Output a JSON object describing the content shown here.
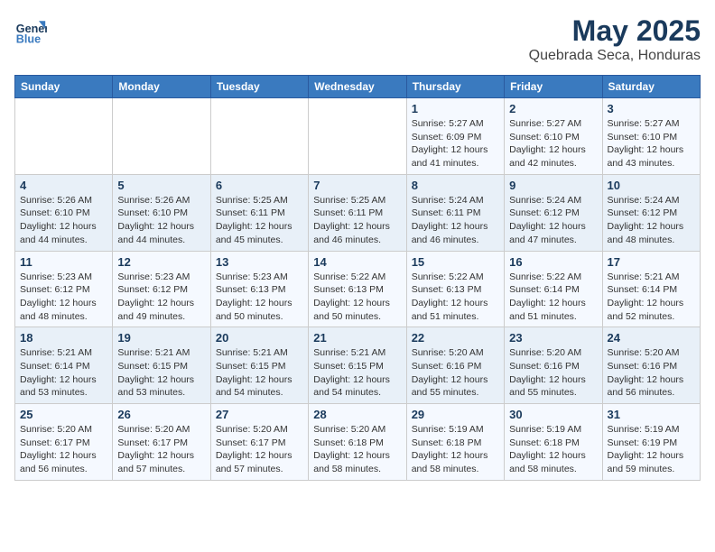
{
  "header": {
    "logo_line1": "General",
    "logo_line2": "Blue",
    "month": "May 2025",
    "location": "Quebrada Seca, Honduras"
  },
  "days_of_week": [
    "Sunday",
    "Monday",
    "Tuesday",
    "Wednesday",
    "Thursday",
    "Friday",
    "Saturday"
  ],
  "weeks": [
    [
      {
        "day": "",
        "info": ""
      },
      {
        "day": "",
        "info": ""
      },
      {
        "day": "",
        "info": ""
      },
      {
        "day": "",
        "info": ""
      },
      {
        "day": "1",
        "info": "Sunrise: 5:27 AM\nSunset: 6:09 PM\nDaylight: 12 hours\nand 41 minutes."
      },
      {
        "day": "2",
        "info": "Sunrise: 5:27 AM\nSunset: 6:10 PM\nDaylight: 12 hours\nand 42 minutes."
      },
      {
        "day": "3",
        "info": "Sunrise: 5:27 AM\nSunset: 6:10 PM\nDaylight: 12 hours\nand 43 minutes."
      }
    ],
    [
      {
        "day": "4",
        "info": "Sunrise: 5:26 AM\nSunset: 6:10 PM\nDaylight: 12 hours\nand 44 minutes."
      },
      {
        "day": "5",
        "info": "Sunrise: 5:26 AM\nSunset: 6:10 PM\nDaylight: 12 hours\nand 44 minutes."
      },
      {
        "day": "6",
        "info": "Sunrise: 5:25 AM\nSunset: 6:11 PM\nDaylight: 12 hours\nand 45 minutes."
      },
      {
        "day": "7",
        "info": "Sunrise: 5:25 AM\nSunset: 6:11 PM\nDaylight: 12 hours\nand 46 minutes."
      },
      {
        "day": "8",
        "info": "Sunrise: 5:24 AM\nSunset: 6:11 PM\nDaylight: 12 hours\nand 46 minutes."
      },
      {
        "day": "9",
        "info": "Sunrise: 5:24 AM\nSunset: 6:12 PM\nDaylight: 12 hours\nand 47 minutes."
      },
      {
        "day": "10",
        "info": "Sunrise: 5:24 AM\nSunset: 6:12 PM\nDaylight: 12 hours\nand 48 minutes."
      }
    ],
    [
      {
        "day": "11",
        "info": "Sunrise: 5:23 AM\nSunset: 6:12 PM\nDaylight: 12 hours\nand 48 minutes."
      },
      {
        "day": "12",
        "info": "Sunrise: 5:23 AM\nSunset: 6:12 PM\nDaylight: 12 hours\nand 49 minutes."
      },
      {
        "day": "13",
        "info": "Sunrise: 5:23 AM\nSunset: 6:13 PM\nDaylight: 12 hours\nand 50 minutes."
      },
      {
        "day": "14",
        "info": "Sunrise: 5:22 AM\nSunset: 6:13 PM\nDaylight: 12 hours\nand 50 minutes."
      },
      {
        "day": "15",
        "info": "Sunrise: 5:22 AM\nSunset: 6:13 PM\nDaylight: 12 hours\nand 51 minutes."
      },
      {
        "day": "16",
        "info": "Sunrise: 5:22 AM\nSunset: 6:14 PM\nDaylight: 12 hours\nand 51 minutes."
      },
      {
        "day": "17",
        "info": "Sunrise: 5:21 AM\nSunset: 6:14 PM\nDaylight: 12 hours\nand 52 minutes."
      }
    ],
    [
      {
        "day": "18",
        "info": "Sunrise: 5:21 AM\nSunset: 6:14 PM\nDaylight: 12 hours\nand 53 minutes."
      },
      {
        "day": "19",
        "info": "Sunrise: 5:21 AM\nSunset: 6:15 PM\nDaylight: 12 hours\nand 53 minutes."
      },
      {
        "day": "20",
        "info": "Sunrise: 5:21 AM\nSunset: 6:15 PM\nDaylight: 12 hours\nand 54 minutes."
      },
      {
        "day": "21",
        "info": "Sunrise: 5:21 AM\nSunset: 6:15 PM\nDaylight: 12 hours\nand 54 minutes."
      },
      {
        "day": "22",
        "info": "Sunrise: 5:20 AM\nSunset: 6:16 PM\nDaylight: 12 hours\nand 55 minutes."
      },
      {
        "day": "23",
        "info": "Sunrise: 5:20 AM\nSunset: 6:16 PM\nDaylight: 12 hours\nand 55 minutes."
      },
      {
        "day": "24",
        "info": "Sunrise: 5:20 AM\nSunset: 6:16 PM\nDaylight: 12 hours\nand 56 minutes."
      }
    ],
    [
      {
        "day": "25",
        "info": "Sunrise: 5:20 AM\nSunset: 6:17 PM\nDaylight: 12 hours\nand 56 minutes."
      },
      {
        "day": "26",
        "info": "Sunrise: 5:20 AM\nSunset: 6:17 PM\nDaylight: 12 hours\nand 57 minutes."
      },
      {
        "day": "27",
        "info": "Sunrise: 5:20 AM\nSunset: 6:17 PM\nDaylight: 12 hours\nand 57 minutes."
      },
      {
        "day": "28",
        "info": "Sunrise: 5:20 AM\nSunset: 6:18 PM\nDaylight: 12 hours\nand 58 minutes."
      },
      {
        "day": "29",
        "info": "Sunrise: 5:19 AM\nSunset: 6:18 PM\nDaylight: 12 hours\nand 58 minutes."
      },
      {
        "day": "30",
        "info": "Sunrise: 5:19 AM\nSunset: 6:18 PM\nDaylight: 12 hours\nand 58 minutes."
      },
      {
        "day": "31",
        "info": "Sunrise: 5:19 AM\nSunset: 6:19 PM\nDaylight: 12 hours\nand 59 minutes."
      }
    ]
  ]
}
